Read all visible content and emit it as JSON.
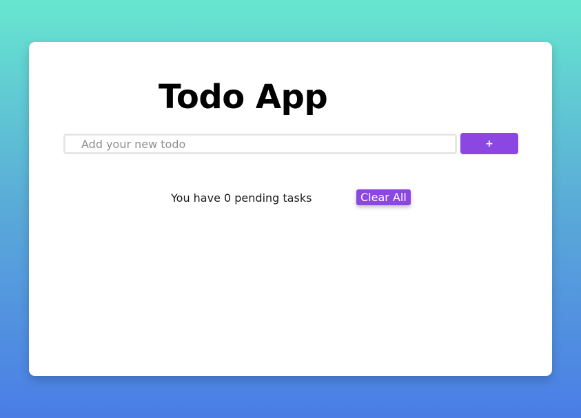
{
  "app": {
    "title": "Todo App"
  },
  "input": {
    "placeholder": "Add your new todo",
    "value": ""
  },
  "add_button": {
    "label": "+"
  },
  "footer": {
    "pending_text": "You have 0 pending tasks",
    "pending_count": 0,
    "clear_label": "Clear All"
  },
  "colors": {
    "accent": "#8c47e3",
    "gradient_top": "#66e6cf",
    "gradient_bottom": "#4a7de6"
  },
  "todos": []
}
